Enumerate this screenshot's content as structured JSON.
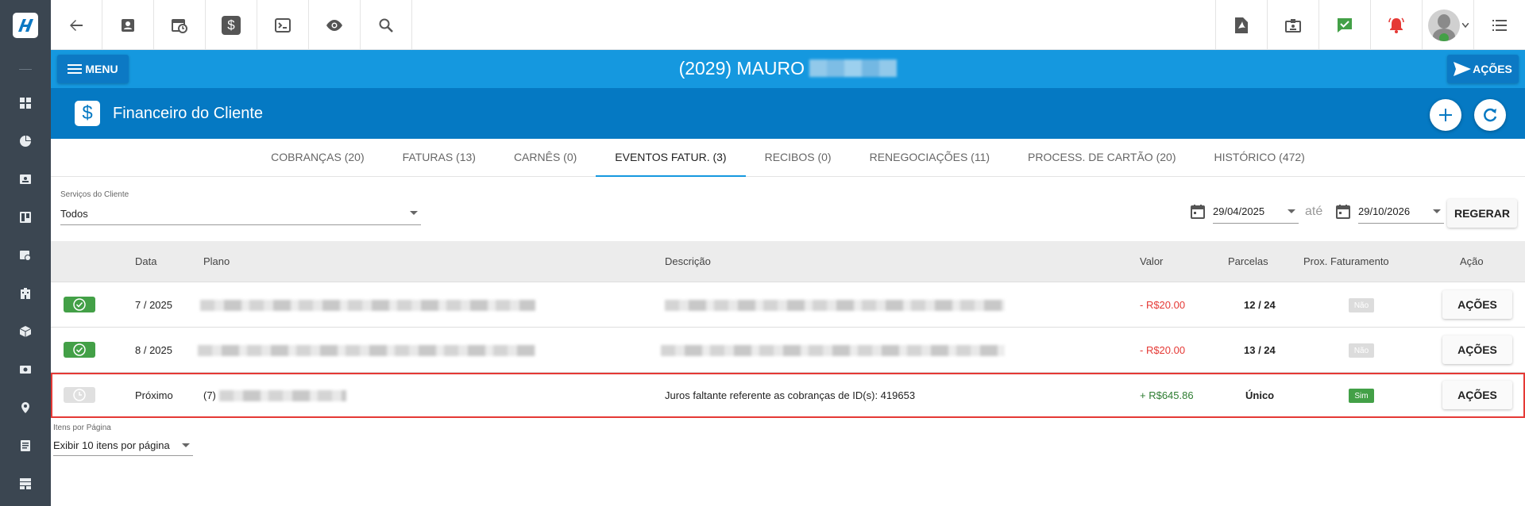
{
  "colors": {
    "primary": "#1598df",
    "primary_dark": "#0579c3",
    "sidebar": "#3b4651",
    "success": "#43a047",
    "danger": "#e53935"
  },
  "sidebar": {
    "items": [
      "dashboard-icon",
      "pie-chart-icon",
      "contact-card-icon",
      "board-icon",
      "calendar-clock-icon",
      "building-icon",
      "package-icon",
      "money-icon",
      "location-icon",
      "document-icon",
      "server-icon"
    ]
  },
  "header": {
    "menu_label": "MENU",
    "client_title": "(2029) MAURO",
    "acoes_label": "AÇÕES"
  },
  "section": {
    "title": "Financeiro do Cliente"
  },
  "tabs": [
    {
      "label": "COBRANÇAS (20)"
    },
    {
      "label": "FATURAS (13)"
    },
    {
      "label": "CARNÊS (0)"
    },
    {
      "label": "EVENTOS FATUR. (3)",
      "active": true
    },
    {
      "label": "RECIBOS (0)"
    },
    {
      "label": "RENEGOCIAÇÕES (11)"
    },
    {
      "label": "PROCESS. DE CARTÃO (20)"
    },
    {
      "label": "HISTÓRICO (472)"
    }
  ],
  "filters": {
    "services_label": "Serviços do Cliente",
    "services_value": "Todos",
    "date_from": "29/04/2025",
    "ate_label": "até",
    "date_to": "29/10/2026",
    "regerar_label": "REGERAR"
  },
  "table": {
    "headers": {
      "data": "Data",
      "plano": "Plano",
      "descricao": "Descrição",
      "valor": "Valor",
      "parcelas": "Parcelas",
      "prox": "Prox. Faturamento",
      "acao": "Ação"
    },
    "rows": [
      {
        "data": "7 / 2025",
        "plano": "",
        "descricao": "",
        "valor": "- R$20.00",
        "parcelas": "12 / 24",
        "prox": "Não",
        "acao": "AÇÕES"
      },
      {
        "data": "8 / 2025",
        "plano": "",
        "descricao": "",
        "valor": "- R$20.00",
        "parcelas": "13 / 24",
        "prox": "Não",
        "acao": "AÇÕES"
      },
      {
        "data": "Próximo",
        "plano": "(7)",
        "descricao": "Juros faltante referente as cobranças de ID(s): 419653",
        "valor": "+ R$645.86",
        "parcelas": "Único",
        "prox": "Sim",
        "acao": "AÇÕES"
      }
    ]
  },
  "pagination": {
    "label": "Itens por Página",
    "value": "Exibir 10 itens por página"
  }
}
